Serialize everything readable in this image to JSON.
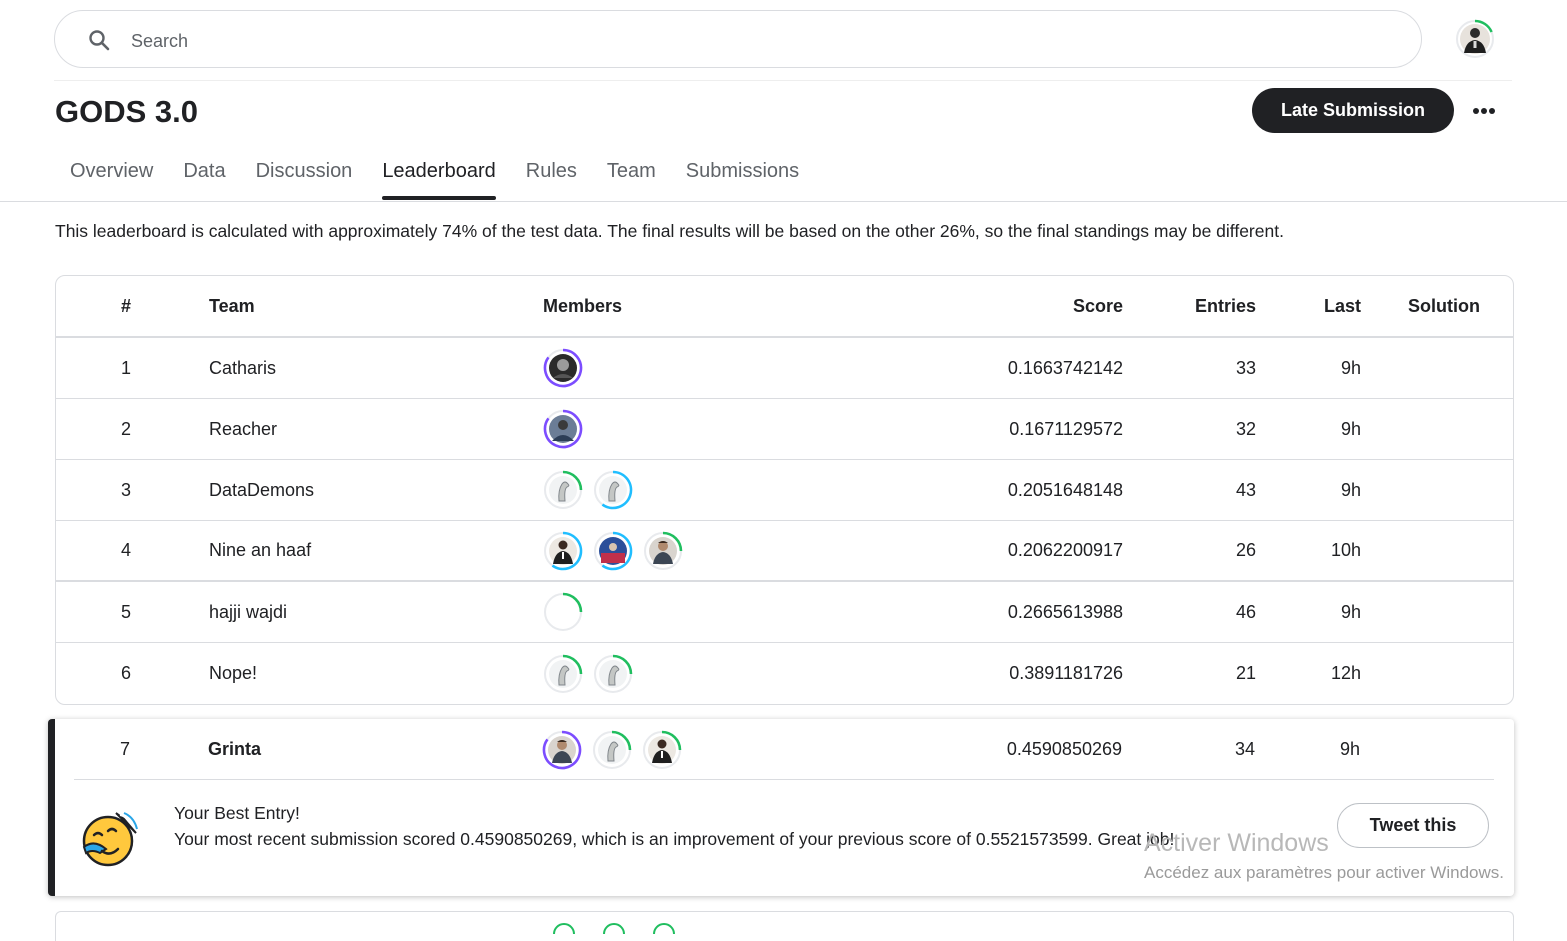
{
  "search": {
    "placeholder": "Search"
  },
  "competition": {
    "title": "GODS 3.0",
    "late_submission_label": "Late Submission",
    "more_label": "More options"
  },
  "tabs": [
    {
      "label": "Overview",
      "active": false
    },
    {
      "label": "Data",
      "active": false
    },
    {
      "label": "Discussion",
      "active": false
    },
    {
      "label": "Leaderboard",
      "active": true
    },
    {
      "label": "Rules",
      "active": false
    },
    {
      "label": "Team",
      "active": false
    },
    {
      "label": "Submissions",
      "active": false
    }
  ],
  "notice": "This leaderboard is calculated with approximately 74% of the test data. The final results will be based on the other 26%, so the final standings may be different.",
  "leaderboard": {
    "columns": {
      "rank": "#",
      "team": "Team",
      "members": "Members",
      "score": "Score",
      "entries": "Entries",
      "last": "Last",
      "solution": "Solution"
    },
    "rows": [
      {
        "rank": "1",
        "team": "Catharis",
        "score": "0.1663742142",
        "entries": "33",
        "last": "9h",
        "members": [
          {
            "icon": "dark-portrait",
            "ring": "#7c4dff",
            "level": 0.85
          }
        ]
      },
      {
        "rank": "2",
        "team": "Reacher",
        "score": "0.1671129572",
        "entries": "32",
        "last": "9h",
        "members": [
          {
            "icon": "photo-portrait",
            "ring": "#7c4dff",
            "level": 0.85
          }
        ]
      },
      {
        "rank": "3",
        "team": "DataDemons",
        "score": "0.2051648148",
        "entries": "43",
        "last": "9h",
        "members": [
          {
            "icon": "default-avatar",
            "ring": "#20be5f",
            "level": 0.25
          },
          {
            "icon": "default-avatar",
            "ring": "#20beff",
            "level": 0.6
          }
        ]
      },
      {
        "rank": "4",
        "team": "Nine an haaf",
        "score": "0.2062200917",
        "entries": "26",
        "last": "10h",
        "members": [
          {
            "icon": "suit-portrait",
            "ring": "#20beff",
            "level": 0.6
          },
          {
            "icon": "crowd-photo",
            "ring": "#20beff",
            "level": 0.6
          },
          {
            "icon": "man-portrait",
            "ring": "#20be5f",
            "level": 0.25
          }
        ]
      },
      {
        "rank": "5",
        "team": "hajji wajdi",
        "score": "0.2665613988",
        "entries": "46",
        "last": "9h",
        "members": [
          {
            "icon": "blank-avatar",
            "ring": "#20be5f",
            "level": 0.25
          }
        ]
      },
      {
        "rank": "6",
        "team": "Nope!",
        "score": "0.3891181726",
        "entries": "21",
        "last": "12h",
        "members": [
          {
            "icon": "default-avatar",
            "ring": "#20be5f",
            "level": 0.25
          },
          {
            "icon": "default-avatar",
            "ring": "#20be5f",
            "level": 0.25
          }
        ]
      }
    ],
    "my_team": {
      "rank": "7",
      "team": "Grinta",
      "score": "0.4590850269",
      "entries": "34",
      "last": "9h",
      "members": [
        {
          "icon": "man-portrait",
          "ring": "#7c4dff",
          "level": 0.85
        },
        {
          "icon": "default-avatar",
          "ring": "#20be5f",
          "level": 0.25
        },
        {
          "icon": "suit-portrait",
          "ring": "#20be5f",
          "level": 0.25
        }
      ]
    },
    "best_entry": {
      "title": "Your Best Entry!",
      "message": "Your most recent submission scored 0.4590850269, which is an improvement of your previous score of 0.5521573599. Great job!",
      "tweet_label": "Tweet this"
    }
  },
  "watermark": {
    "title": "Activer Windows",
    "subtitle": "Accédez aux paramètres pour activer Windows."
  }
}
